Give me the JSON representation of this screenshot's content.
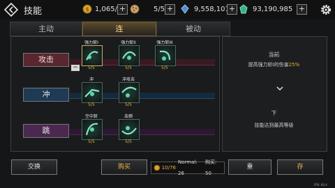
{
  "header": {
    "title": "技能",
    "resources": [
      {
        "icon": "gold-coin-icon",
        "value": "1,065/10"
      },
      {
        "icon": "cookie-icon",
        "value": "5/5"
      },
      {
        "icon": "blue-crystal-icon",
        "value": "9,558,101"
      },
      {
        "icon": "green-gem-icon",
        "value": "93,190,985"
      }
    ],
    "plus_symbol": "+"
  },
  "tabs": [
    {
      "label": "主动",
      "active": false
    },
    {
      "label": "连",
      "active": true
    },
    {
      "label": "被动",
      "active": false
    }
  ],
  "categories": [
    {
      "label": "攻击"
    },
    {
      "label": "冲"
    },
    {
      "label": "跳"
    }
  ],
  "skills": [
    {
      "name": "强力斩I",
      "count": "5/5"
    },
    {
      "name": "强力斩II",
      "count": "5/5"
    },
    {
      "name": "强力斩III",
      "count": "5/5"
    },
    {
      "name": "冲",
      "count": "5/5"
    },
    {
      "name": "冲攻击",
      "count": "5/5"
    },
    {
      "name": "空中斩",
      "count": "5/5"
    },
    {
      "name": "击倒",
      "count": "5/5"
    }
  ],
  "minus_symbol": "−",
  "detail": {
    "current_label": "当前",
    "current_desc": "提高强力斩I的伤害",
    "current_value": "25%",
    "next_label": "下",
    "next_desc": "技能达到最高等级"
  },
  "bottom": {
    "exchange_label": "交换",
    "buy_label": "购买",
    "stat_text": "10/76",
    "normal_label": "Normal: 26",
    "buy_count": "购买: 50",
    "reset_label": "重",
    "save_label": "存"
  },
  "fps": "FPS: 60.4",
  "colors": {
    "accent": "#e3b63e",
    "attack": "#5a2630",
    "dash": "#1e3a55",
    "jump": "#4a2850"
  }
}
